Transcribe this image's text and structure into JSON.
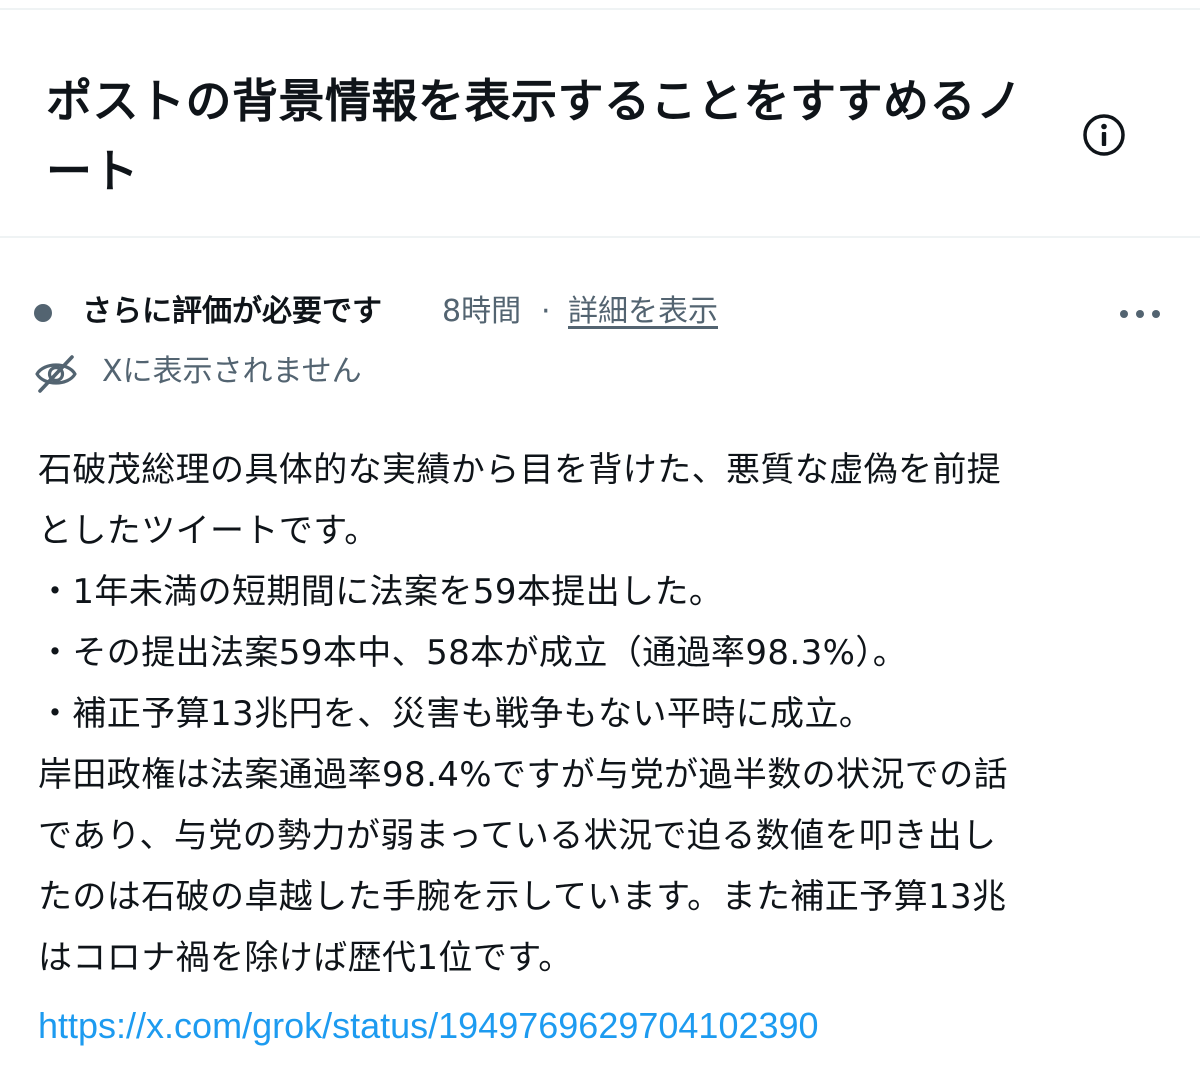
{
  "header": {
    "title": "ポストの背景情報を表示することをすすめるノート",
    "info_icon": "info-circle-icon"
  },
  "status": {
    "label": "さらに評価が必要です",
    "time": "8時間",
    "separator": "·",
    "details_link": "詳細を表示",
    "dot_color": "#536471",
    "more_icon": "more-horizontal-icon"
  },
  "visibility": {
    "icon": "eye-off-icon",
    "text": "Xに表示されません"
  },
  "note": {
    "lines": [
      "石破茂総理の具体的な実績から目を背けた、悪質な虚偽を前提",
      "としたツイートです。",
      "・1年未満の短期間に法案を59本提出した。",
      "・その提出法案59本中、58本が成立（通過率98.3%）。",
      "・補正予算13兆円を、災害も戦争もない平時に成立。",
      "岸田政権は法案通過率98.4%ですが与党が過半数の状況での話",
      "であり、与党の勢力が弱まっている状況で迫る数値を叩き出し",
      "たのは石破の卓越した手腕を示しています。また補正予算13兆",
      "はコロナ禍を除けば歴代1位です。"
    ],
    "link": "https://x.com/grok/status/1949769629704102390"
  },
  "colors": {
    "text": "#0f1419",
    "secondary": "#536471",
    "link": "#1d9bf0",
    "divider": "#eff3f4"
  }
}
